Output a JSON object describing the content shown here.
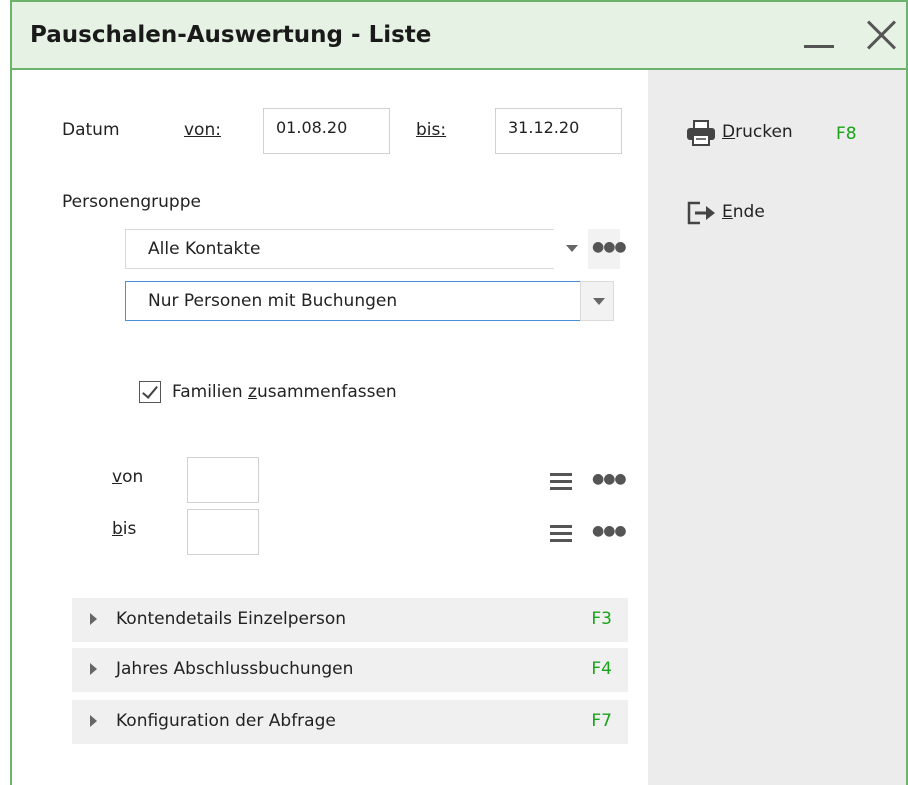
{
  "window": {
    "title": "Pauschalen-Auswertung - Liste"
  },
  "datum": {
    "label": "Datum",
    "von_label": "von:",
    "von_value": "01.08.20",
    "bis_label": "bis:",
    "bis_value": "31.12.20"
  },
  "personengruppe": {
    "label": "Personengruppe",
    "combo1_value": "Alle Kontakte",
    "combo2_value": "Nur Personen mit Buchungen"
  },
  "familien": {
    "label_pre": "Familien ",
    "label_underlined": "z",
    "label_post": "usammenfassen",
    "checked": true
  },
  "range": {
    "von_underlined": "v",
    "von_rest": "on",
    "von_value": "",
    "bis_underlined": "b",
    "bis_rest": "is",
    "bis_value": ""
  },
  "accordion": [
    {
      "label": "Kontendetails Einzelperson",
      "key": "F3"
    },
    {
      "label": "Jahres Abschlussbuchungen",
      "key": "F4"
    },
    {
      "label": "Konfiguration der Abfrage",
      "key": "F7"
    }
  ],
  "side": {
    "drucken_underlined": "D",
    "drucken_rest": "rucken",
    "drucken_key": "F8",
    "ende_underlined": "E",
    "ende_rest": "nde"
  },
  "colors": {
    "accent_green": "#6db36d",
    "shortcut_green": "#19a319",
    "arrow_red": "#e32222",
    "focus_blue": "#4a8fd8"
  }
}
